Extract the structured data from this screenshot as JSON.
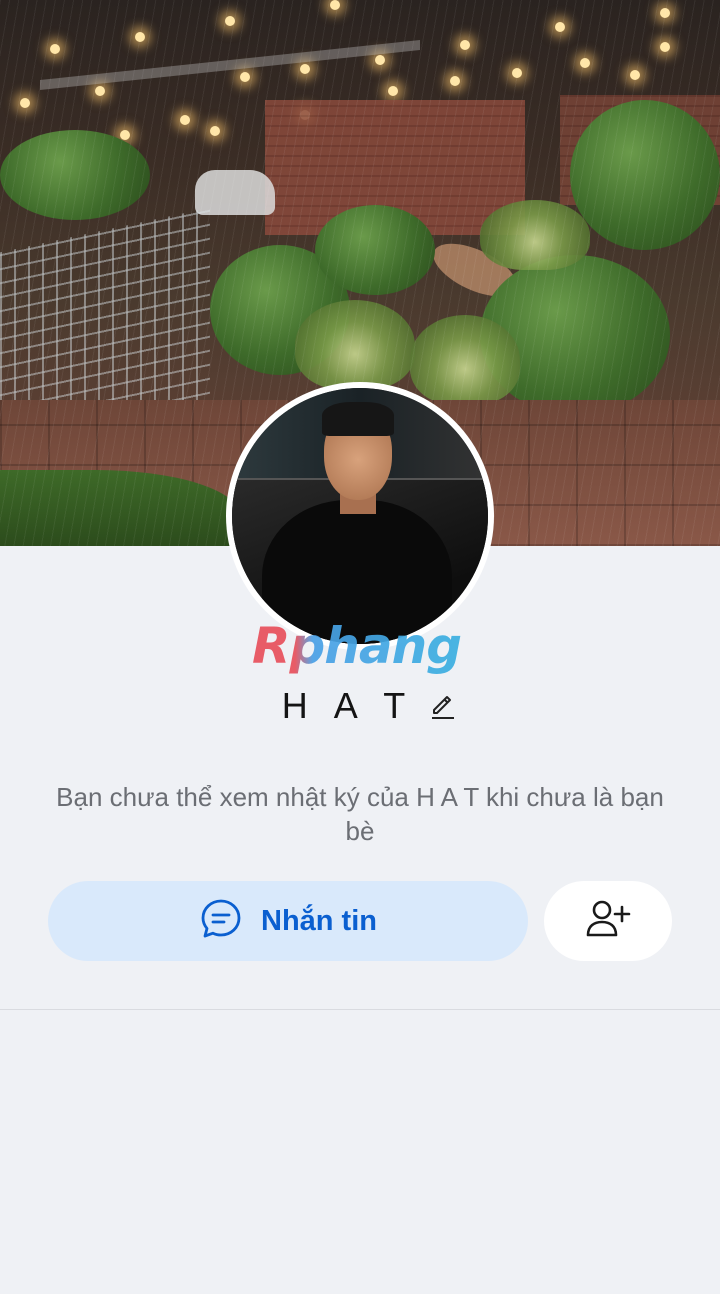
{
  "profile": {
    "name": "H A T",
    "notice": "Bạn chưa thể xem nhật ký của H A T khi chưa là bạn bè"
  },
  "watermark": {
    "text": "Rphang"
  },
  "actions": {
    "message_label": "Nhắn tin",
    "message_icon": "chat-bubble-icon",
    "add_friend_icon": "add-friend-icon"
  },
  "icons": {
    "edit": "pencil-icon"
  },
  "colors": {
    "background": "#eff1f5",
    "primary_blue": "#0a5fd0",
    "message_button_bg": "#d9e9fb",
    "secondary_text": "#6b6e74"
  }
}
